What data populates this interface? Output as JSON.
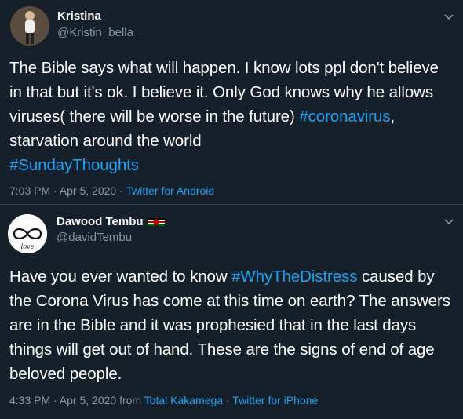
{
  "tweets": [
    {
      "name": "Kristina",
      "handle": "@Kristin_bella_",
      "text_parts": [
        {
          "text": "The Bible says what will happen.  I know lots ppl don't believe in that but it's ok. I believe it. Only God knows why he allows viruses( there will be worse in the future) "
        },
        {
          "text": "#coronavirus",
          "hashtag": true
        },
        {
          "text": ", starvation around the world "
        },
        {
          "text": "#SundayThoughts",
          "hashtag": true
        }
      ],
      "time": "7:03 PM · Apr 5, 2020 · ",
      "source": "Twitter for Android",
      "avatar_icon": "person-photo-icon"
    },
    {
      "name": "Dawood Tembu",
      "handle": "@davidTembu",
      "flag_icon": "kenya-flag-icon",
      "avatar_icon": "infinity-love-icon",
      "avatar_text": "love",
      "text_parts": [
        {
          "text": "Have you ever wanted to know  "
        },
        {
          "text": "#WhyTheDistress",
          "hashtag": true
        },
        {
          "text": " caused by the Corona Virus has come at this time on earth? The answers are in the Bible and it was prophesied that in the last days things will get out of hand. These are the signs of end of age beloved people."
        }
      ],
      "time": "4:33 PM · Apr 5, 2020 from ",
      "location": "Total Kakamega",
      "separator": " · ",
      "source": "Twitter for iPhone"
    }
  ],
  "colors": {
    "background": "#15202b",
    "hashtag": "#1da1f2",
    "secondary_text": "#8899a6",
    "divider": "#38444d"
  }
}
